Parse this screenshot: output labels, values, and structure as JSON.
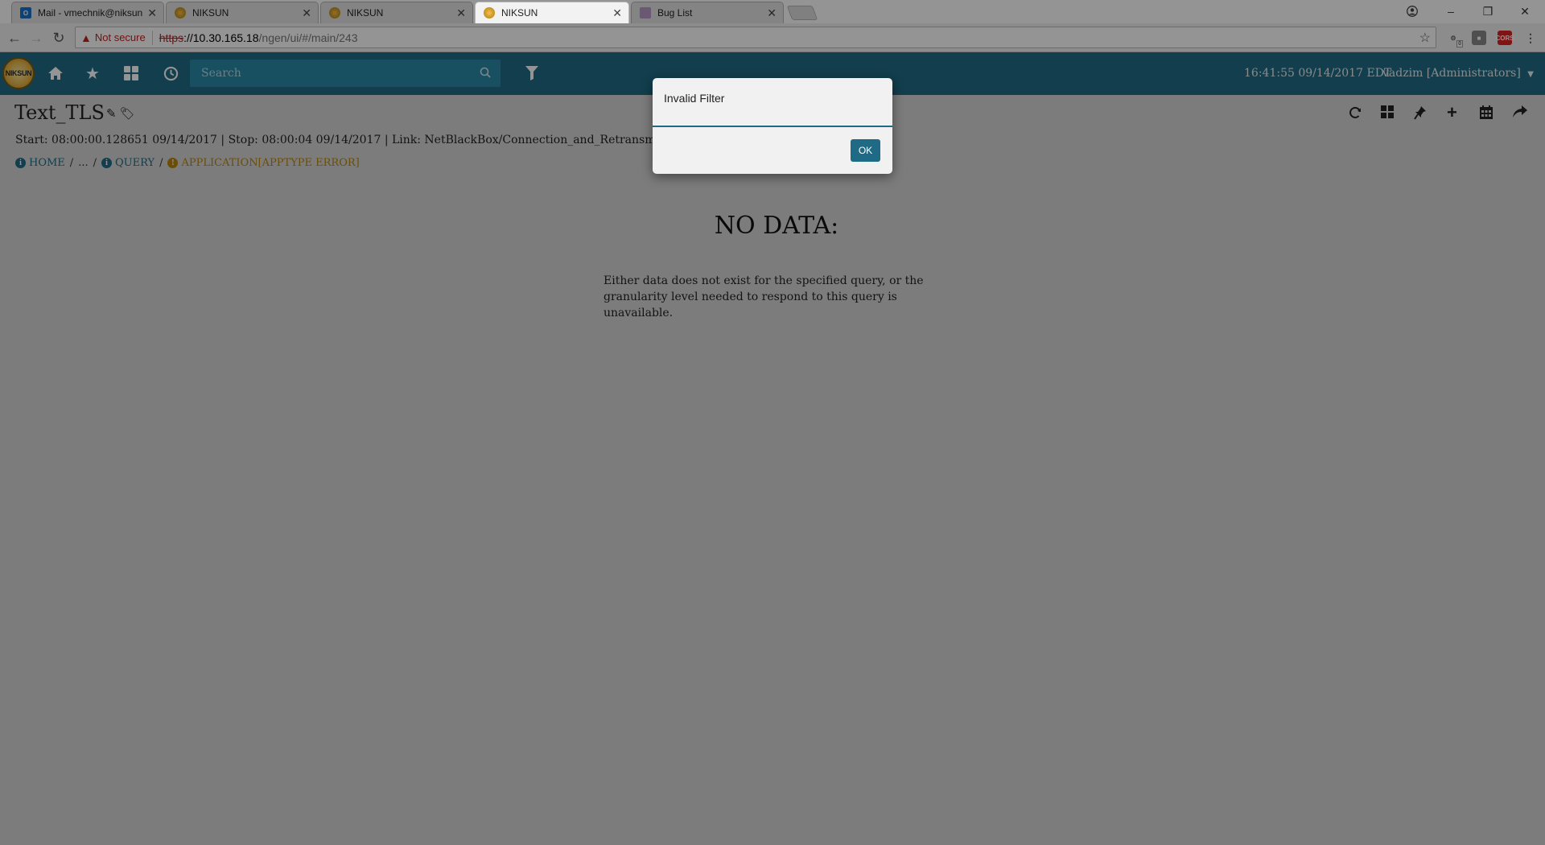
{
  "browser": {
    "tabs": [
      {
        "title": "Mail - vmechnik@niksun",
        "favicon": "outlook-icon",
        "active": false
      },
      {
        "title": "NIKSUN",
        "favicon": "niksun-icon",
        "active": false
      },
      {
        "title": "NIKSUN",
        "favicon": "niksun-icon",
        "active": false
      },
      {
        "title": "NIKSUN",
        "favicon": "niksun-icon",
        "active": true
      },
      {
        "title": "Bug List",
        "favicon": "bug-icon",
        "active": false
      }
    ],
    "security_label": "Not secure",
    "url_scheme": "https",
    "url_host": "://10.30.165.18",
    "url_path": "/ngen/ui/#/main/243",
    "ext_badge": "0",
    "ext_cors": "CORS"
  },
  "app": {
    "logo_text": "NIKSUN",
    "search_placeholder": "Search",
    "datetime": "16:41:55  09/14/2017 EDT",
    "user": "vadzim [Administrators]",
    "colors": {
      "header": "#1f6b86",
      "ok_button": "#1f6b86",
      "error": "#b8860b"
    }
  },
  "page": {
    "title": "Text_TLS",
    "info": "Start: 08:00:00.128651 09/14/2017 | Stop: 08:00:04 09/14/2017 | Link: NetBlackBox/Connection_and_Retransmitted_Bytes_",
    "breadcrumb": {
      "home": "HOME",
      "ellipsis": "...",
      "query": "QUERY",
      "error": "APPLICATION[APPTYPE ERROR]"
    },
    "no_data_title": "NO DATA:",
    "no_data_line1": "Either data does not exist for the specified query, or the",
    "no_data_line2": "granularity level needed to respond to this query is unavailable."
  },
  "dialog": {
    "title": "Invalid Filter",
    "ok_label": "OK"
  }
}
